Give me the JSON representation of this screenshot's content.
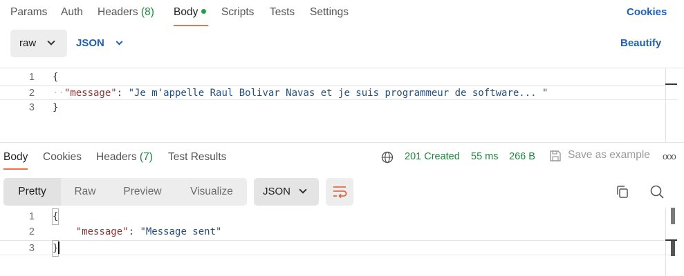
{
  "request": {
    "tabs": [
      {
        "label": "Params"
      },
      {
        "label": "Auth"
      },
      {
        "label": "Headers",
        "count": "(8)"
      },
      {
        "label": "Body"
      },
      {
        "label": "Scripts"
      },
      {
        "label": "Tests"
      },
      {
        "label": "Settings"
      }
    ],
    "cookies_link": "Cookies",
    "body_mode": "raw",
    "body_language": "JSON",
    "beautify_label": "Beautify",
    "editor_lines": [
      {
        "num": "1",
        "text": "{"
      },
      {
        "num": "2",
        "key": "\"message\"",
        "colon": ": ",
        "value": "\"Je m'appelle Raul Bolivar Navas et je suis programmeur de software... \""
      },
      {
        "num": "3",
        "text": "}"
      }
    ]
  },
  "response": {
    "tabs": [
      {
        "label": "Body"
      },
      {
        "label": "Cookies"
      },
      {
        "label": "Headers",
        "count": "(7)"
      },
      {
        "label": "Test Results"
      }
    ],
    "status": "201 Created",
    "time": "55 ms",
    "size": "266 B",
    "save_example_label": "Save as example",
    "more_label": "ooo",
    "format_tabs": [
      {
        "label": "Pretty"
      },
      {
        "label": "Raw"
      },
      {
        "label": "Preview"
      },
      {
        "label": "Visualize"
      }
    ],
    "language": "JSON",
    "editor_lines": [
      {
        "num": "1",
        "text": "{"
      },
      {
        "num": "2",
        "key": "\"message\"",
        "colon": ": ",
        "value": "\"Message sent\""
      },
      {
        "num": "3",
        "text": "}"
      }
    ]
  },
  "colors": {
    "accent": "#ff6c37",
    "link_blue": "#1f5fbf",
    "status_green": "#1a8a3c"
  },
  "icons": [
    "chevron-down-icon",
    "globe-icon",
    "save-icon",
    "wrap-lines-icon",
    "copy-icon",
    "search-icon",
    "more-icon"
  ]
}
